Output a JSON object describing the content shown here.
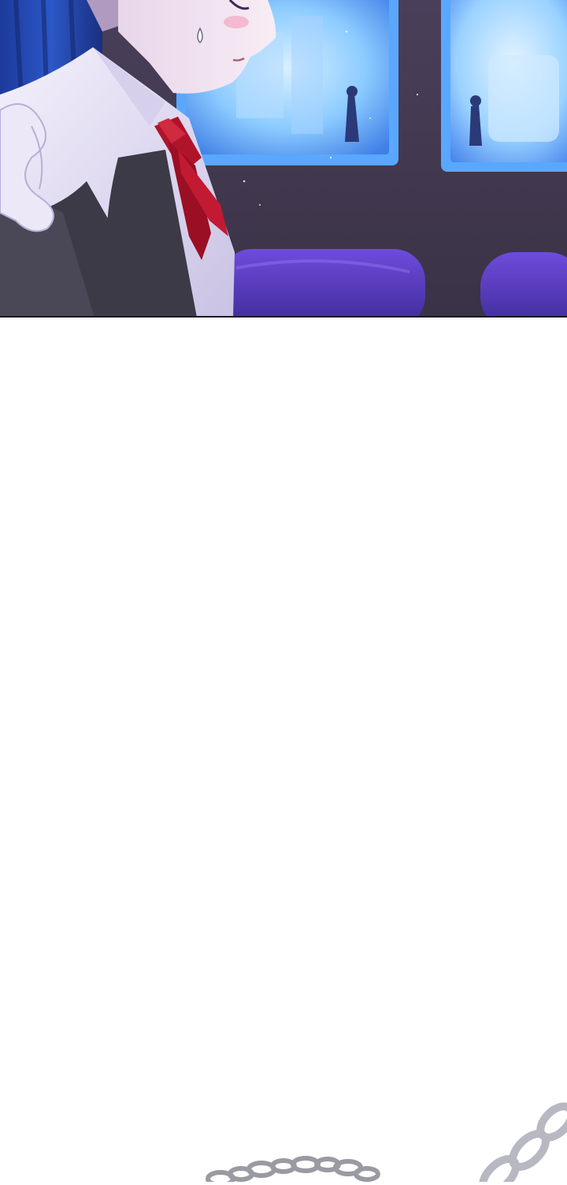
{
  "page": {
    "background_color": "#ffffff"
  },
  "panel": {
    "scene": "night-interior",
    "icons": {
      "character": "character-figure-icon",
      "ribbon": "ribbon-icon",
      "window_left": "window-icon",
      "window_right": "window-icon",
      "sofa_left": "sofa-icon",
      "sofa_right": "sofa-icon",
      "sweat_drop": "sweat-drop-icon"
    },
    "colors": {
      "wall": "#3a3048",
      "window_glow": "#7fc4ff",
      "window_frame": "#5aa7ff",
      "curtain": "#2448a8",
      "sofa": "#5a3cc8",
      "ribbon": "#b0142a",
      "shirt": "#e8e4f6",
      "vest": "#3c3a46",
      "skin": "#f0e2ee",
      "hair": "#b09ac0"
    }
  },
  "decoration": {
    "chain_icon": "chain-icon",
    "chain_color": "#9a9aa2"
  }
}
